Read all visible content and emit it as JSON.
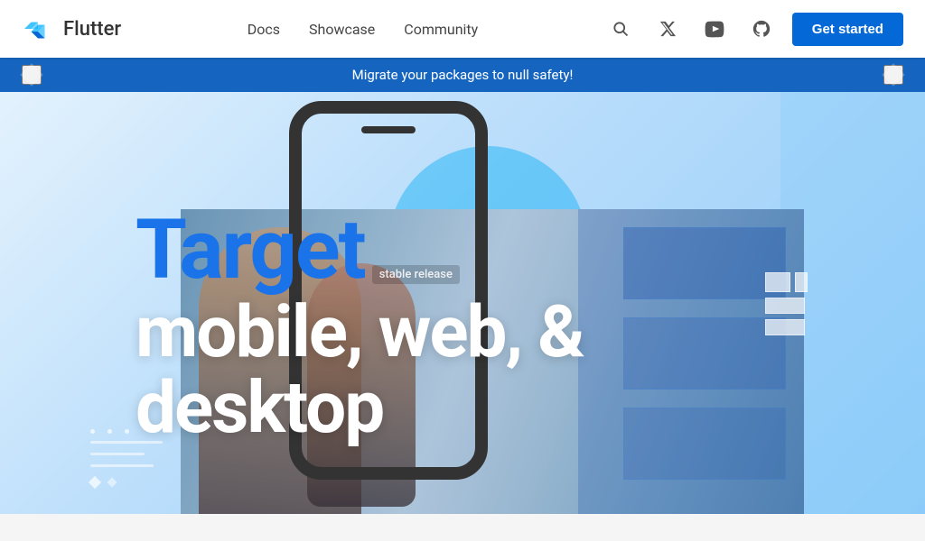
{
  "nav": {
    "logo_text": "Flutter",
    "docs_label": "Docs",
    "showcase_label": "Showcase",
    "community_label": "Community",
    "get_started_label": "Get started"
  },
  "banner": {
    "message": "Migrate your packages to null safety!",
    "prev_label": "◆",
    "next_label": "◆"
  },
  "hero": {
    "target_label": "Target",
    "release_badge": "stable release",
    "subtitle_line1": "mobile, web, &",
    "subtitle_line2": "desktop"
  },
  "icons": {
    "search": "🔍",
    "twitter": "𝕏",
    "youtube": "▶",
    "github": "⊙"
  }
}
